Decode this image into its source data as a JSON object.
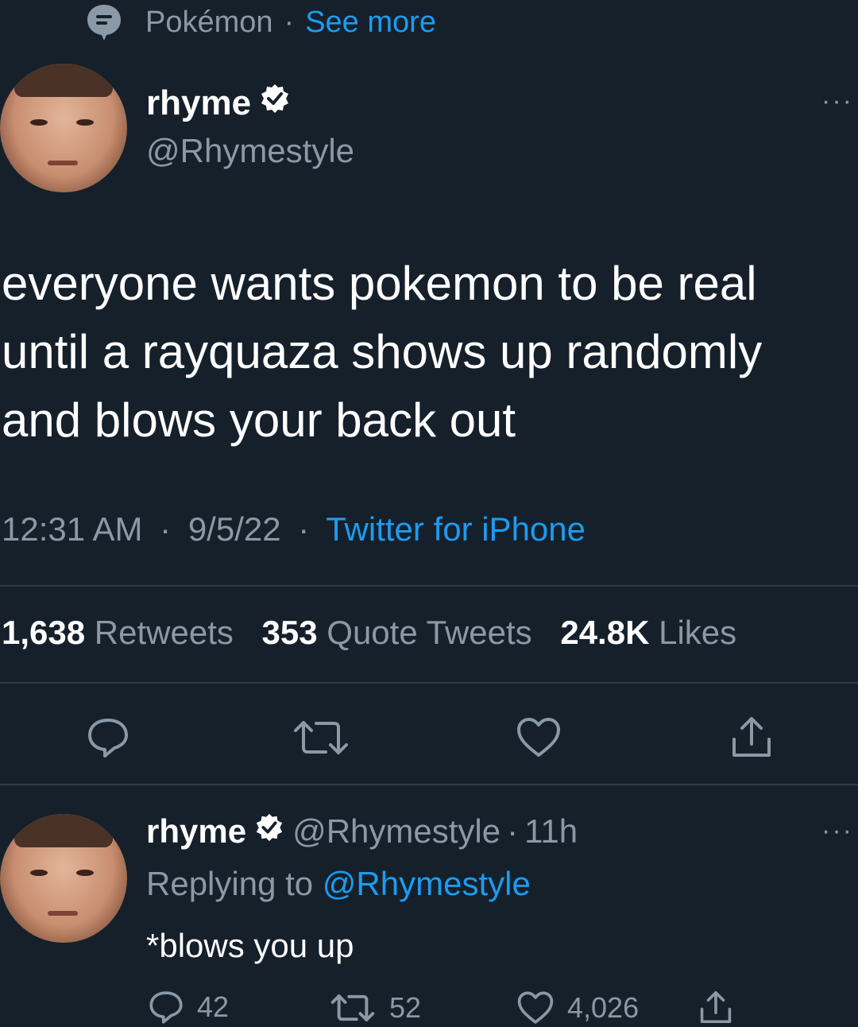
{
  "topic": {
    "label": "Pokémon",
    "separator": "·",
    "see_more": "See more"
  },
  "tweet": {
    "display_name": "rhyme",
    "handle": "@Rhymestyle",
    "more_label": "···",
    "text_lines": [
      "everyone wants pokemon to be real",
      "until a rayquaza shows up randomly",
      "and blows your back out"
    ],
    "time": "12:31 AM",
    "sep1": "·",
    "date": "9/5/22",
    "sep2": "·",
    "source": "Twitter for iPhone",
    "stats": {
      "retweets_count": "1,638",
      "retweets_label": "Retweets",
      "quotes_count": "353",
      "quotes_label": "Quote Tweets",
      "likes_count": "24.8K",
      "likes_label": "Likes"
    }
  },
  "reply": {
    "display_name": "rhyme",
    "handle": "@Rhymestyle",
    "sep": "·",
    "age": "11h",
    "replying_label": "Replying to",
    "replying_handle": "@Rhymestyle",
    "more_label": "···",
    "text": "*blows you up",
    "counts": {
      "replies": "42",
      "retweets": "52",
      "likes": "4,026"
    }
  },
  "colors": {
    "background": "#15202b",
    "text": "#ffffff",
    "muted": "#8b98a5",
    "accent": "#1d9bf0",
    "divider": "#2f3b47"
  },
  "icons": [
    "topic-icon",
    "verified-badge-icon",
    "more-icon",
    "reply-icon",
    "retweet-icon",
    "like-icon",
    "share-icon"
  ]
}
